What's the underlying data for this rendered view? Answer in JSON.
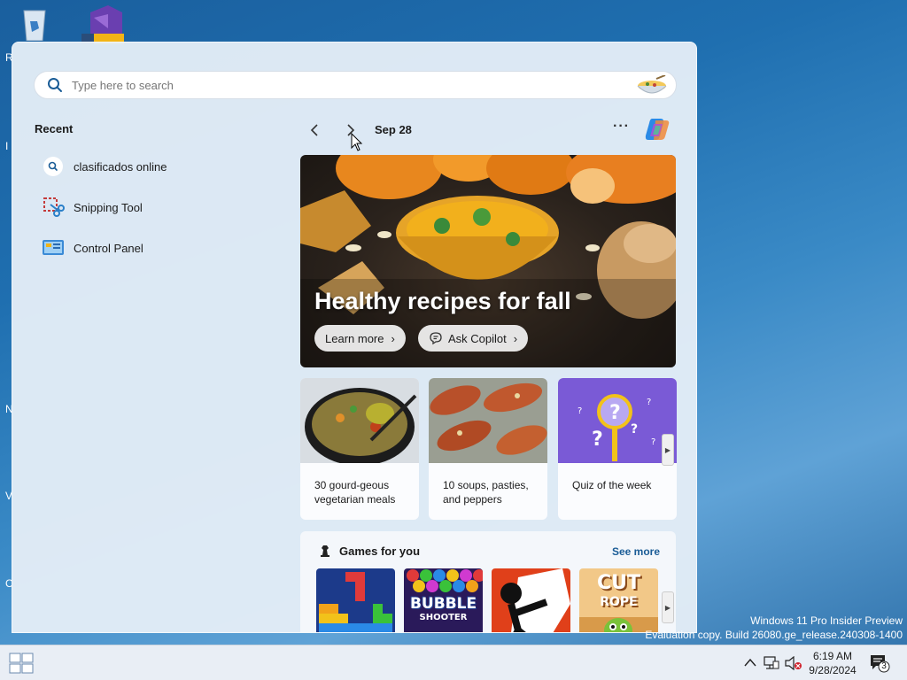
{
  "search": {
    "placeholder": "Type here to search"
  },
  "recent": {
    "title": "Recent",
    "items": [
      {
        "label": "clasificados online",
        "icon": "search-icon"
      },
      {
        "label": "Snipping Tool",
        "icon": "snipping-tool-icon"
      },
      {
        "label": "Control Panel",
        "icon": "control-panel-icon"
      }
    ]
  },
  "feed": {
    "date": "Sep 28",
    "hero": {
      "title": "Healthy recipes for fall",
      "learn_more": "Learn more",
      "ask_copilot": "Ask Copilot"
    },
    "cards": [
      {
        "text": "30 gourd-geous vegetarian meals"
      },
      {
        "text": "10 soups, pasties, and peppers"
      },
      {
        "text": "Quiz of the week"
      }
    ],
    "games": {
      "title": "Games for you",
      "see_more": "See more",
      "tiles": [
        {
          "name": "block-puzzle"
        },
        {
          "name": "Bubble Shooter",
          "label": "BUBBLE",
          "sublabel": "SHOOTER"
        },
        {
          "name": "stickman-fight"
        },
        {
          "name": "Cut the Rope",
          "label": "CUT",
          "sublabel": "ROPE"
        }
      ]
    }
  },
  "watermark": {
    "line1": "Windows 11 Pro Insider Preview",
    "line2": "Evaluation copy. Build 26080.ge_release.240308-1400"
  },
  "taskbar": {
    "time": "6:19 AM",
    "date": "9/28/2024",
    "notification_count": "3"
  },
  "colors": {
    "accent": "#1a5c96",
    "panel_bg": "#e2ecf6",
    "desktop": "#1f6fb0"
  }
}
